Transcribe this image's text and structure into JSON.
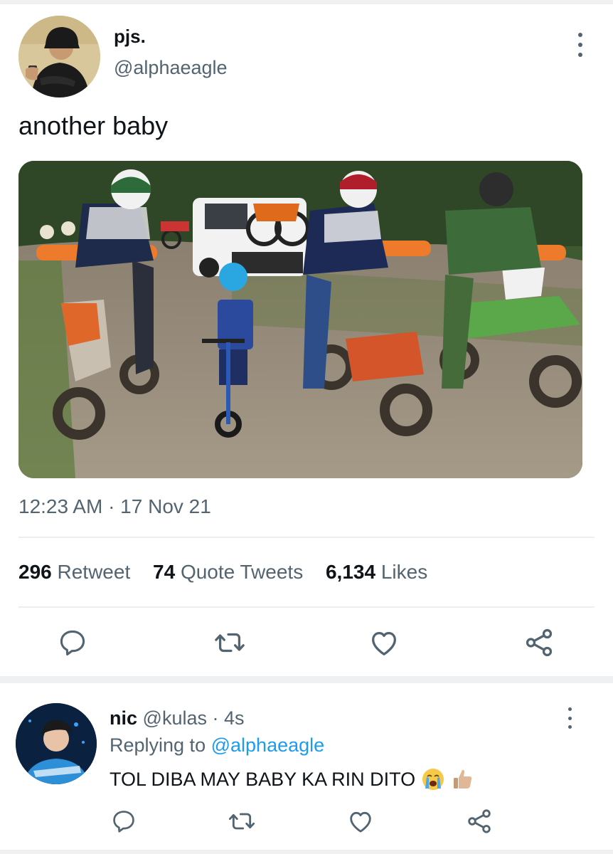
{
  "tweet": {
    "display_name": "pjs.",
    "handle": "@alphaeagle",
    "text": "another baby",
    "timestamp": "12:23 AM · 17 Nov 21",
    "stats": {
      "retweets_count": "296",
      "retweets_label": "Retweet",
      "quotes_count": "74",
      "quotes_label": "Quote Tweets",
      "likes_count": "6,134",
      "likes_label": "Likes"
    },
    "photo_icon": "photo-motocross-riders-with-toddler-on-balance-bike",
    "actions": [
      "reply-icon",
      "retweet-icon",
      "like-icon",
      "share-icon"
    ]
  },
  "reply": {
    "display_name": "nic",
    "handle": "@kulas",
    "time": "· 4s",
    "replying_prefix": "Replying to",
    "replying_to": "@alphaeagle",
    "text": "TOL DIBA MAY BABY KA RIN DITO",
    "emojis": [
      "loudly-crying-face-emoji",
      "thumbs-up-emoji"
    ],
    "actions": [
      "reply-icon",
      "retweet-icon",
      "like-icon",
      "share-icon"
    ]
  },
  "colors": {
    "text_primary": "#0f1419",
    "text_secondary": "#536471",
    "link": "#1d9bf0",
    "divider": "#eceff1",
    "band": "#eef0f1"
  }
}
